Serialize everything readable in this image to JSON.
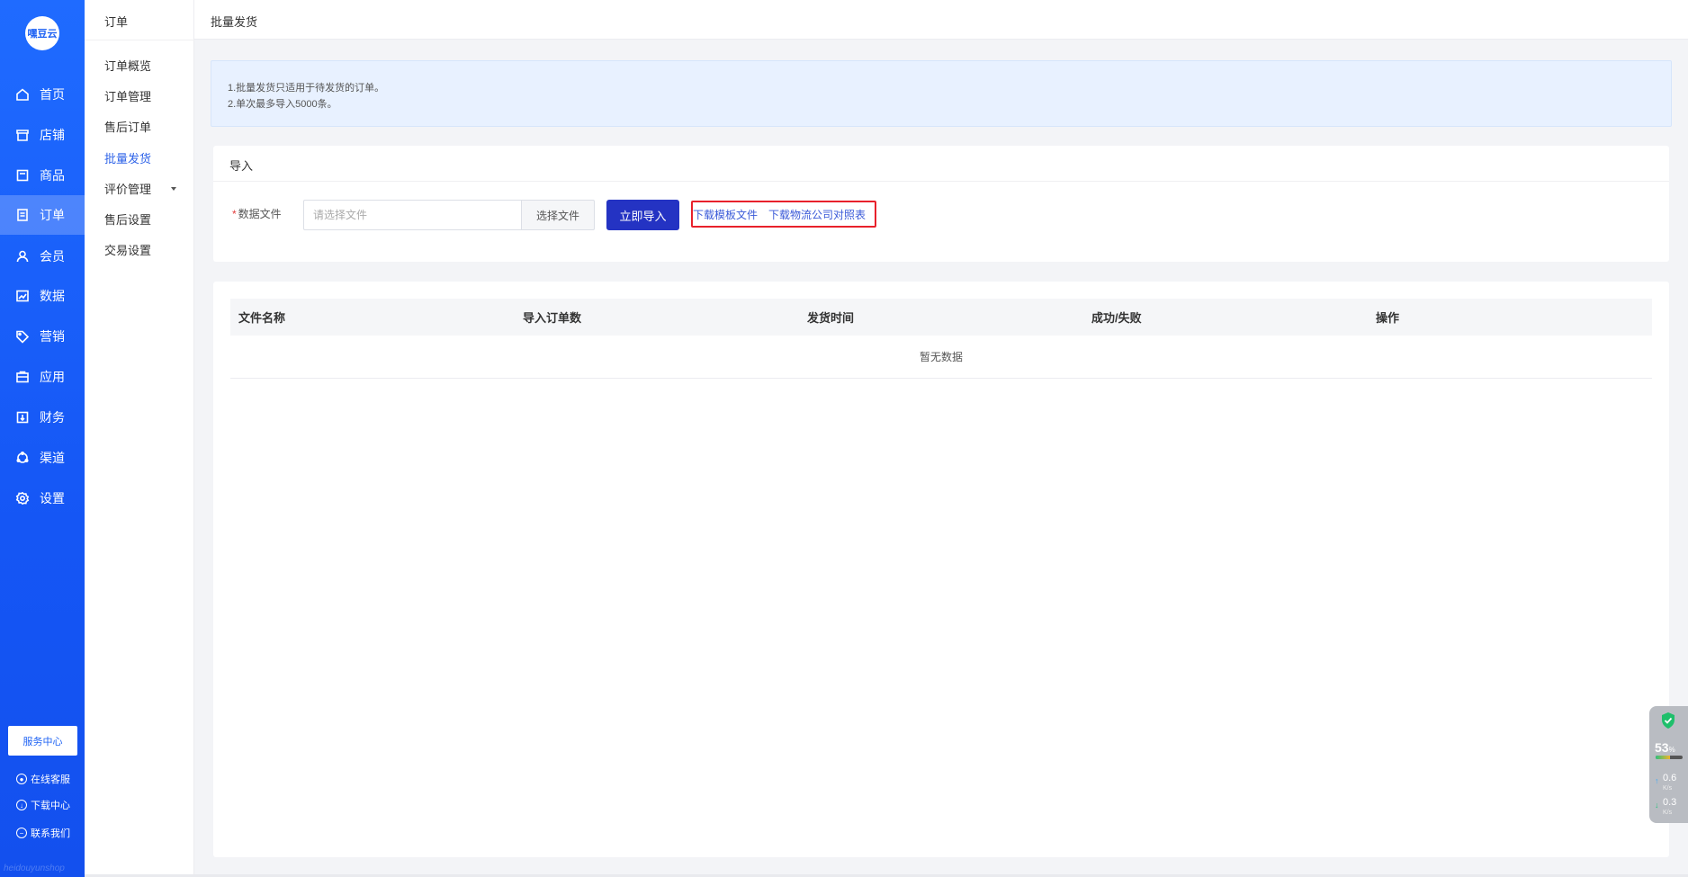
{
  "sidebar": {
    "logo": "嘿豆云",
    "items": [
      {
        "label": "首页",
        "icon": "home-icon"
      },
      {
        "label": "店铺",
        "icon": "shop-icon"
      },
      {
        "label": "商品",
        "icon": "goods-icon"
      },
      {
        "label": "订单",
        "icon": "order-icon"
      },
      {
        "label": "会员",
        "icon": "member-icon"
      },
      {
        "label": "数据",
        "icon": "data-icon"
      },
      {
        "label": "营销",
        "icon": "tag-icon"
      },
      {
        "label": "应用",
        "icon": "app-icon"
      },
      {
        "label": "财务",
        "icon": "finance-icon"
      },
      {
        "label": "渠道",
        "icon": "channel-icon"
      },
      {
        "label": "设置",
        "icon": "gear-icon"
      }
    ],
    "service_center": "服务中心",
    "links": [
      "在线客服",
      "下载中心",
      "联系我们"
    ],
    "watermark": "heidouyunshop"
  },
  "submenu": {
    "title": "订单",
    "items": [
      "订单概览",
      "订单管理",
      "售后订单",
      "批量发货",
      "评价管理",
      "售后设置",
      "交易设置"
    ]
  },
  "topbar": {
    "title": "批量发货"
  },
  "notice": {
    "lines": [
      "1.批量发货只适用于待发货的订单。",
      "2.单次最多导入5000条。"
    ]
  },
  "import_card": {
    "title": "导入",
    "required_mark": "*",
    "label": "数据文件",
    "placeholder": "请选择文件",
    "choose_button": "选择文件",
    "import_button": "立即导入",
    "download_template": "下载模板文件",
    "download_logistics": "下载物流公司对照表"
  },
  "table": {
    "headers": [
      "文件名称",
      "导入订单数",
      "发货时间",
      "成功/失败",
      "操作"
    ],
    "empty_text": "暂无数据"
  },
  "net_widget": {
    "percent": "53",
    "percent_unit": "%",
    "up_speed": "0.6",
    "down_speed": "0.3",
    "speed_unit": "K/s"
  },
  "colors": {
    "sidebar_blue": "#1f6bff",
    "primary_button": "#2433c3",
    "link_blue": "#3a5ad8",
    "highlight_red": "#e8212b",
    "active_submenu": "#2e63e8"
  }
}
